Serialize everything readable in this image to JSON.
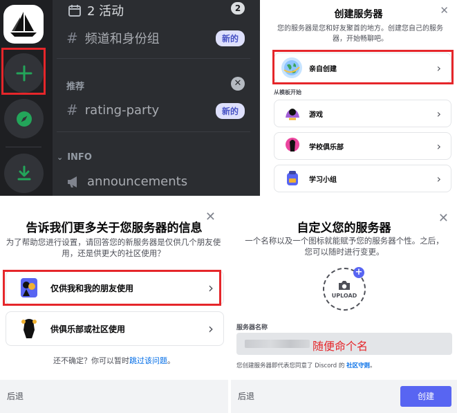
{
  "sidebar": {
    "channels": [
      {
        "label": "2 活动",
        "badge": "2"
      },
      {
        "label": "频道和身份组",
        "tag": "新的"
      }
    ],
    "recommended": {
      "title": "推荐",
      "channel": "rating-party",
      "tag": "新的"
    },
    "info_section": {
      "title": "INFO",
      "channel": "announcements"
    }
  },
  "create": {
    "title": "创建服务器",
    "subtitle": "您的服务器是您和好友聚首的地方。创建您自己的服务器，开始畅聊吧。",
    "own_option": "亲自创建",
    "template_heading": "从模板开始",
    "templates": [
      "游戏",
      "学校俱乐部",
      "学习小组"
    ]
  },
  "tell": {
    "title": "告诉我们更多关于您服务器的信息",
    "subtitle": "为了帮助您进行设置，请回答您的新服务器是仅供几个朋友使用，还是供更大的社区使用？",
    "options": [
      "仅供我和我的朋友使用",
      "供俱乐部或社区使用"
    ],
    "unsure_text": "还不确定？你可以暂时",
    "skip_link": "跳过该问题",
    "unsure_end": "。",
    "back": "后退"
  },
  "customize": {
    "title": "自定义您的服务器",
    "subtitle": "一个名称以及一个图标就能赋予您的服务器个性。之后，您可以随时进行变更。",
    "upload": "UPLOAD",
    "name_label": "服务器名称",
    "name_annotation": "随便命个名",
    "terms_text": "您创建服务器即代表您同意了 Discord 的",
    "terms_link": "社区守则",
    "terms_end": "。",
    "back": "后退",
    "create_button": "创建"
  },
  "colors": {
    "accent": "#5865f2",
    "link": "#006ce7",
    "highlight": "#e5262a",
    "annotation": "#e5262a"
  }
}
